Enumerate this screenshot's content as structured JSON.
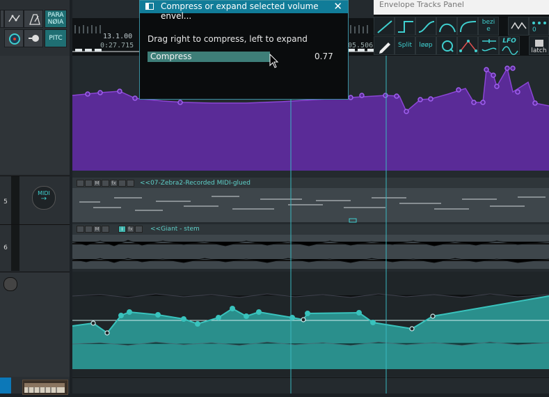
{
  "toolbar": {
    "paranoia_label": "PARA\nNØIA",
    "pitch_label": "PITC"
  },
  "ruler": {
    "time_top": "13.1.00",
    "time_bottom": "0:27.715",
    "time_right": "05.506"
  },
  "tracks": [
    {
      "number": "5",
      "midi_label": "MIDI",
      "item_name": "<<07-Zebra2-Recorded MIDI-glued"
    },
    {
      "number": "6",
      "item_name": "<<Giant - stem"
    }
  ],
  "dialog": {
    "title": "Compress or expand selected volume envel...",
    "close_glyph": "✕",
    "instruction": "Drag right to compress, left to expand",
    "slider_label": "Compress",
    "value": "0.77",
    "value_fraction": 0.63
  },
  "envelope_panel": {
    "title": "Envelope Tracks Panel",
    "bezier_label": "bezi\ne",
    "zero_label": "0",
    "split_label": "Split",
    "loop_label": "løøp",
    "lfo_label": "LFO",
    "latch_label": "latch"
  },
  "colors": {
    "purple": "#5a2b97",
    "teal": "#2a8f8c",
    "accent": "#3fd0d0",
    "dialog_title": "#117c98"
  }
}
